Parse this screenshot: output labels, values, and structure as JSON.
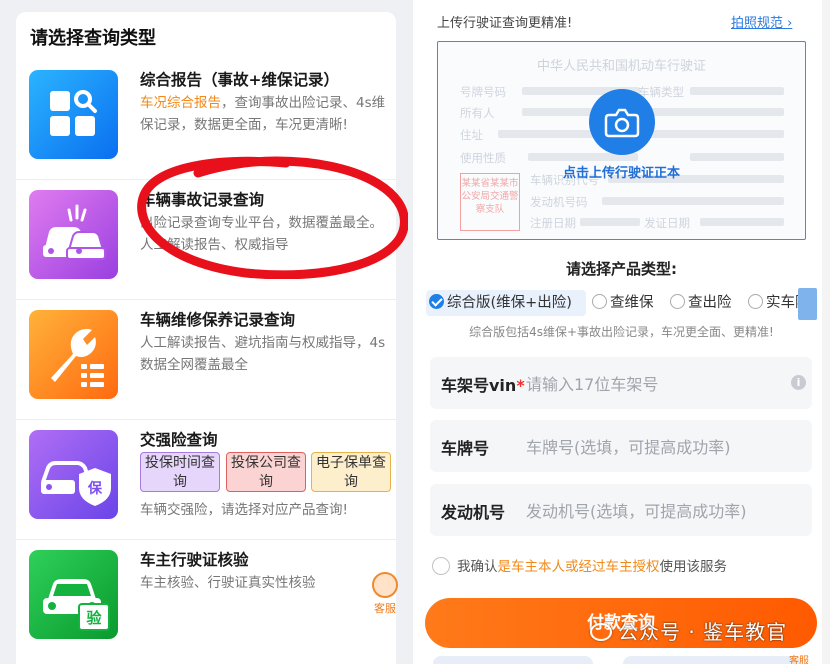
{
  "left": {
    "title": "请选择查询类型",
    "items": [
      {
        "title": "综合报告（事故+维保记录）",
        "desc_highlight": "车况综合报告",
        "desc_rest": "，查询事故出险记录、4s维保记录，数据更全面，车况更清晰!",
        "icon": "grid-search-icon"
      },
      {
        "title": "车辆事故记录查询",
        "desc": "出险记录查询专业平台，数据覆盖最全。人工解读报告、权威指导",
        "icon": "crashed-cars-icon"
      },
      {
        "title": "车辆维修保养记录查询",
        "desc": "人工解读报告、避坑指南与权威指导，4s数据全网覆盖最全",
        "icon": "wrench-list-icon"
      },
      {
        "title": "交强险查询",
        "tags": [
          "投保时间查询",
          "投保公司查询",
          "电子保单查询"
        ],
        "desc": "车辆交强险，请选择对应产品查询!",
        "icon": "car-insurance-icon"
      },
      {
        "title": "车主行驶证核验",
        "desc": "车主核验、行驶证真实性核验",
        "icon": "car-verify-icon"
      }
    ],
    "kefu_label": "客服"
  },
  "right": {
    "upload_tip": "上传行驶证查询更精准!",
    "photo_guide": "拍照规范",
    "license": {
      "title": "中华人民共和国机动车行驶证",
      "labels": [
        "号牌号码",
        "车辆类型",
        "所有人",
        "住址",
        "使用性质",
        "车辆识别代号",
        "发动机号码",
        "注册日期",
        "发证日期"
      ],
      "seal": "某某省某某市公安局交通警察支队",
      "cta": "点击上传行驶证正本"
    },
    "product_title": "请选择产品类型:",
    "options": [
      "综合版(维保+出险)",
      "查维保",
      "查出险",
      "实车险"
    ],
    "selected_option": 0,
    "option_desc": "综合版包括4s维保+事故出险记录，车况更全面、更精准!",
    "fields": {
      "vin_label": "车架号vin",
      "vin_required": "*",
      "vin_placeholder": "请输入17位车架号",
      "plate_label": "车牌号",
      "plate_placeholder": "车牌号(选填，可提高成功率)",
      "engine_label": "发动机号",
      "engine_placeholder": "发动机号(选填，可提高成功率)"
    },
    "agree": {
      "prefix": "我确认",
      "highlight": "是车主本人或经过车主授权",
      "suffix": "使用该服务"
    },
    "pay_button": "付款查询",
    "kefu_label": "客服"
  },
  "watermark": "公众号 · 鉴车教官",
  "colors": {
    "accent": "#1f7fe6",
    "orange": "#ff6a10",
    "highlight": "#f08a1a",
    "annotation": "#e8101a"
  }
}
